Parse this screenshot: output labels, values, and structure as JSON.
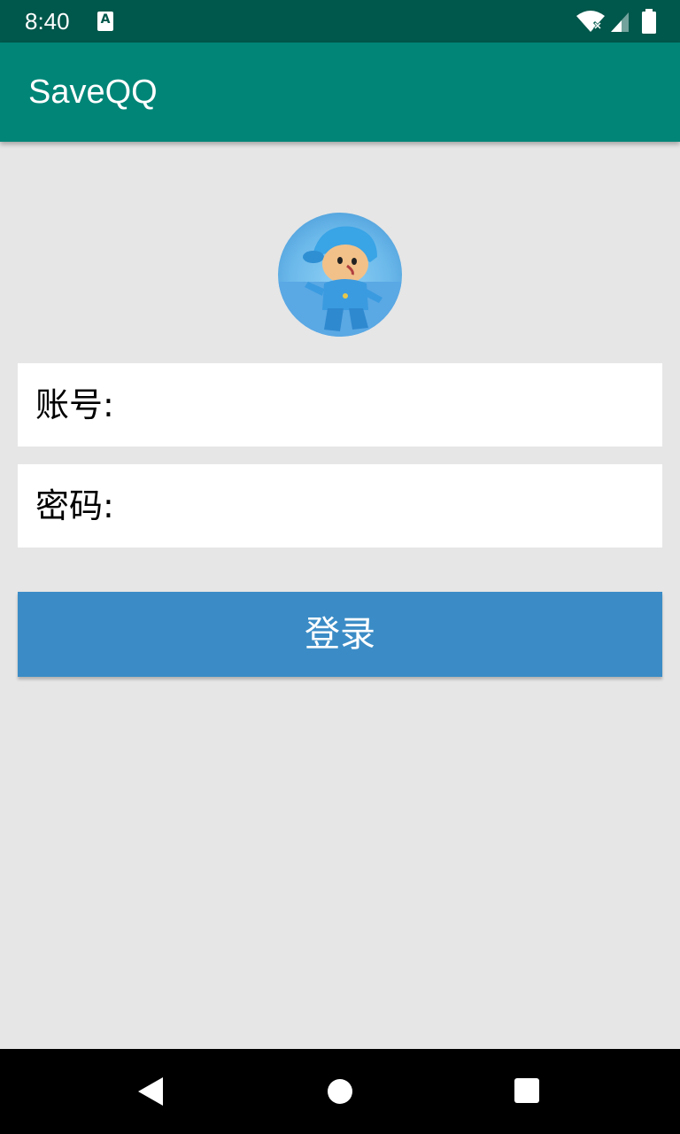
{
  "status_bar": {
    "time": "8:40",
    "notification_letter": "A",
    "icons": [
      "notification-a-icon",
      "wifi-off-icon",
      "cell-signal-icon",
      "battery-icon"
    ]
  },
  "app_bar": {
    "title": "SaveQQ",
    "color": "#008577"
  },
  "form": {
    "avatar": "pocoyo-avatar",
    "account_label": "账号:",
    "account_value": "",
    "password_label": "密码:",
    "password_value": "",
    "login_label": "登录",
    "login_color": "#3b8cc6"
  },
  "nav_bar": {
    "icons": [
      "back-icon",
      "home-icon",
      "recents-icon"
    ]
  }
}
